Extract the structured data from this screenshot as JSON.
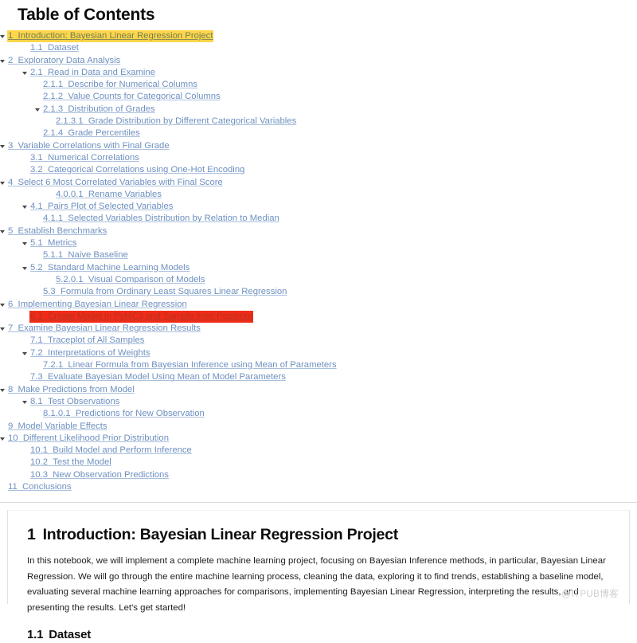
{
  "toc": {
    "title": "Table of Contents",
    "items": [
      {
        "num": "1",
        "label": "Introduction: Bayesian Linear Regression Project",
        "level": 0,
        "caret": true,
        "highlight": "yellow"
      },
      {
        "num": "1.1",
        "label": "Dataset",
        "level": 1,
        "caret": false,
        "highlight": "none"
      },
      {
        "num": "2",
        "label": "Exploratory Data Analysis",
        "level": 0,
        "caret": true,
        "highlight": "none"
      },
      {
        "num": "2.1",
        "label": "Read in Data and Examine",
        "level": 1,
        "caret": true,
        "highlight": "none"
      },
      {
        "num": "2.1.1",
        "label": "Describe for Numerical Columns",
        "level": 2,
        "caret": false,
        "highlight": "none"
      },
      {
        "num": "2.1.2",
        "label": "Value Counts for Categorical Columns",
        "level": 2,
        "caret": false,
        "highlight": "none"
      },
      {
        "num": "2.1.3",
        "label": "Distribution of Grades",
        "level": 2,
        "caret": true,
        "highlight": "none"
      },
      {
        "num": "2.1.3.1",
        "label": "Grade Distribution by Different Categorical Variables",
        "level": 3,
        "caret": false,
        "highlight": "none"
      },
      {
        "num": "2.1.4",
        "label": "Grade Percentiles",
        "level": 2,
        "caret": false,
        "highlight": "none"
      },
      {
        "num": "3",
        "label": "Variable Correlations with Final Grade",
        "level": 0,
        "caret": true,
        "highlight": "none"
      },
      {
        "num": "3.1",
        "label": "Numerical Correlations",
        "level": 1,
        "caret": false,
        "highlight": "none"
      },
      {
        "num": "3.2",
        "label": "Categorical Correlations using One-Hot Encoding",
        "level": 1,
        "caret": false,
        "highlight": "none"
      },
      {
        "num": "4",
        "label": "Select 6 Most Correlated Variables with Final Score",
        "level": 0,
        "caret": true,
        "highlight": "none"
      },
      {
        "num": "4.0.0.1",
        "label": "Rename Variables",
        "level": 3,
        "caret": false,
        "highlight": "none"
      },
      {
        "num": "4.1",
        "label": "Pairs Plot of Selected Variables",
        "level": 1,
        "caret": true,
        "highlight": "none"
      },
      {
        "num": "4.1.1",
        "label": "Selected Variables Distribution by Relation to Median",
        "level": 2,
        "caret": false,
        "highlight": "none"
      },
      {
        "num": "5",
        "label": "Establish Benchmarks",
        "level": 0,
        "caret": true,
        "highlight": "none"
      },
      {
        "num": "5.1",
        "label": "Metrics",
        "level": 1,
        "caret": true,
        "highlight": "none"
      },
      {
        "num": "5.1.1",
        "label": "Naive Baseline",
        "level": 2,
        "caret": false,
        "highlight": "none"
      },
      {
        "num": "5.2",
        "label": "Standard Machine Learning Models",
        "level": 1,
        "caret": true,
        "highlight": "none"
      },
      {
        "num": "5.2.0.1",
        "label": "Visual Comparison of Models",
        "level": 3,
        "caret": false,
        "highlight": "none"
      },
      {
        "num": "5.3",
        "label": "Formula from Ordinary Least Squares Linear Regression",
        "level": 2,
        "caret": false,
        "highlight": "none"
      },
      {
        "num": "6",
        "label": "Implementing Bayesian Linear Regression",
        "level": 0,
        "caret": true,
        "highlight": "none"
      },
      {
        "num": "6.1",
        "label": "Create Model in PyMC3 and Sample from Posterior",
        "level": 1,
        "caret": false,
        "highlight": "red"
      },
      {
        "num": "7",
        "label": "Examine Bayesian Linear Regression Results",
        "level": 0,
        "caret": true,
        "highlight": "none"
      },
      {
        "num": "7.1",
        "label": "Traceplot of All Samples",
        "level": 1,
        "caret": false,
        "highlight": "none"
      },
      {
        "num": "7.2",
        "label": "Interpretations of Weights",
        "level": 1,
        "caret": true,
        "highlight": "none"
      },
      {
        "num": "7.2.1",
        "label": "Linear Formula from Bayesian Inference using Mean of Parameters",
        "level": 2,
        "caret": false,
        "highlight": "none"
      },
      {
        "num": "7.3",
        "label": "Evaluate Bayesian Model Using Mean of Model Parameters",
        "level": 1,
        "caret": false,
        "highlight": "none"
      },
      {
        "num": "8",
        "label": "Make Predictions from Model",
        "level": 0,
        "caret": true,
        "highlight": "none"
      },
      {
        "num": "8.1",
        "label": "Test Observations",
        "level": 1,
        "caret": true,
        "highlight": "none"
      },
      {
        "num": "8.1.0.1",
        "label": "Predictions for New Observation",
        "level": 2,
        "caret": false,
        "highlight": "none"
      },
      {
        "num": "9",
        "label": "Model Variable Effects",
        "level": 0,
        "caret": false,
        "highlight": "none"
      },
      {
        "num": "10",
        "label": "Different Likelihood Prior Distribution",
        "level": 0,
        "caret": true,
        "highlight": "none"
      },
      {
        "num": "10.1",
        "label": "Build Model and Perform Inference",
        "level": 1,
        "caret": false,
        "highlight": "none"
      },
      {
        "num": "10.2",
        "label": "Test the Model",
        "level": 1,
        "caret": false,
        "highlight": "none"
      },
      {
        "num": "10.3",
        "label": "New Observation Predictions",
        "level": 1,
        "caret": false,
        "highlight": "none"
      },
      {
        "num": "11",
        "label": "Conclusions",
        "level": 0,
        "caret": false,
        "highlight": "none"
      }
    ]
  },
  "content": {
    "heading1_num": "1",
    "heading1_text": "Introduction: Bayesian Linear Regression Project",
    "paragraph": "In this notebook, we will implement a complete machine learning project, focusing on Bayesian Inference methods, in particular, Bayesian Linear Regression. We will go through the entire machine learning process, cleaning the data, exploring it to find trends, establishing a baseline model, evaluating several machine learning approaches for comparisons, implementing Bayesian Linear Regression, interpreting the results, and presenting the results. Let's get started!",
    "heading2_num": "1.1",
    "heading2_text": "Dataset"
  },
  "watermark": "@ITPUB博客",
  "colors": {
    "link": "#6e90c0",
    "highlight_yellow": "#ffd54a",
    "highlight_red": "#f02b18",
    "text": "#0d0d0d"
  }
}
